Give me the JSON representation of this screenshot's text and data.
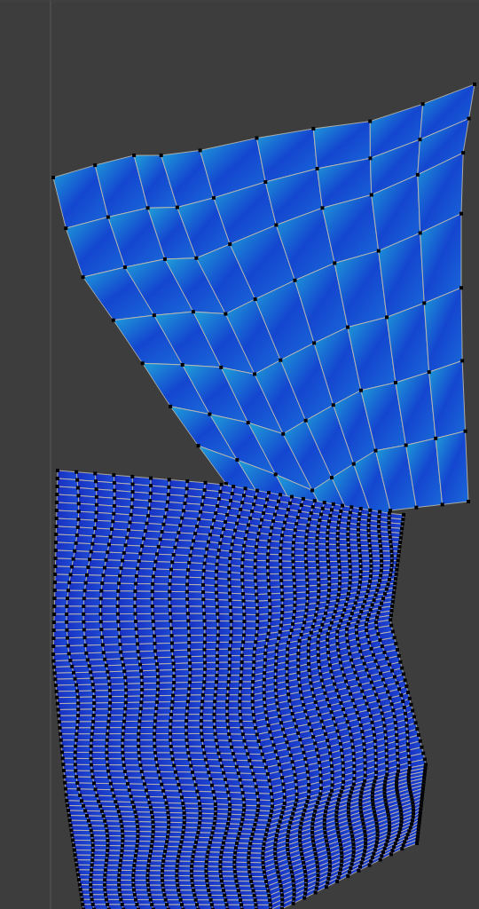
{
  "uv_editor": {
    "show_grid": true,
    "show_vertices": true
  }
}
